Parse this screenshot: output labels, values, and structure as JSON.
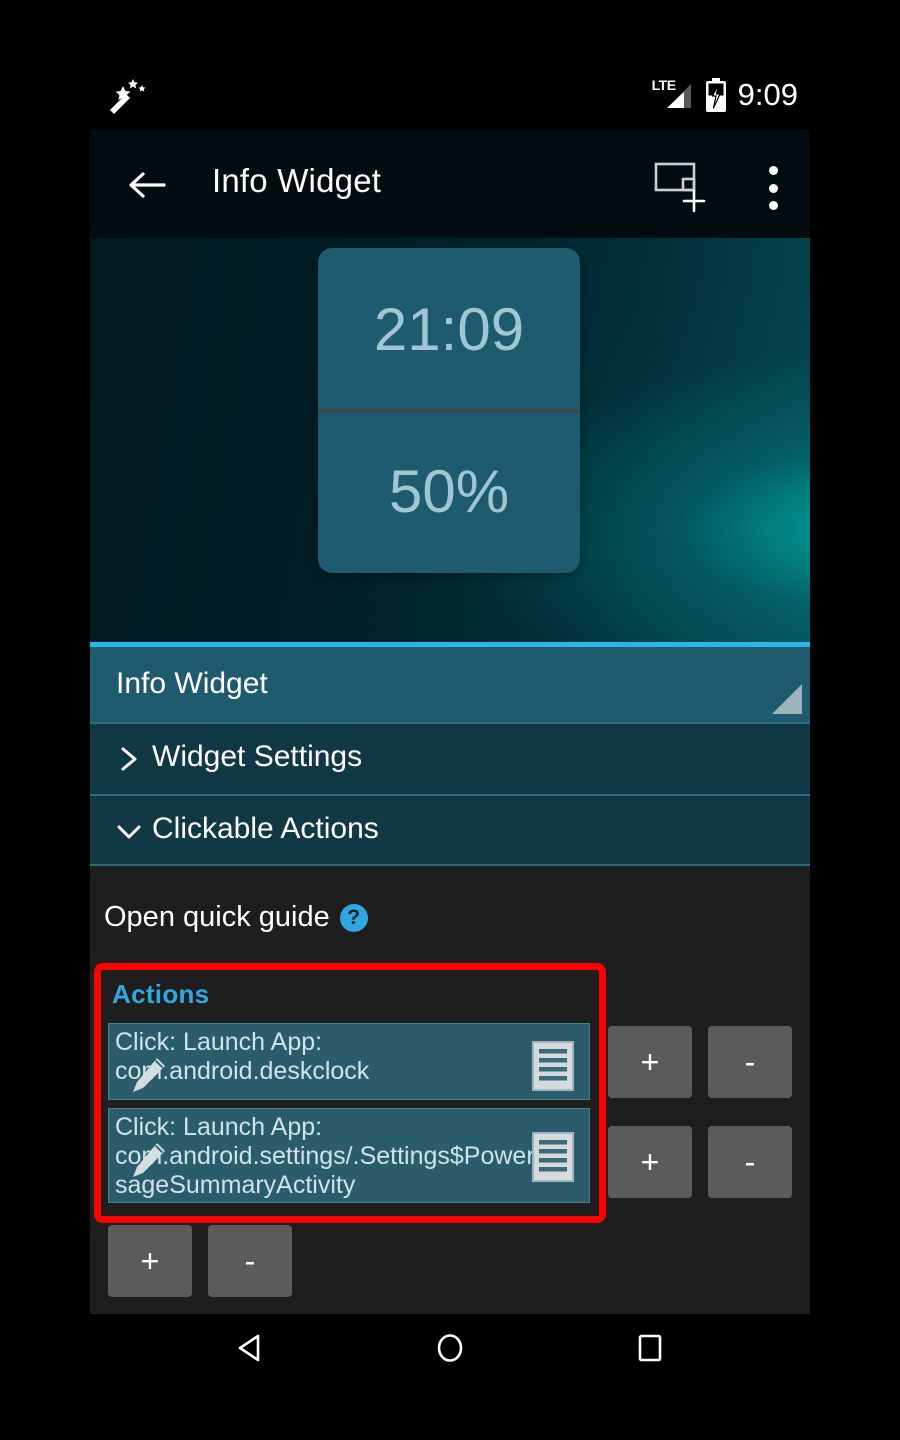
{
  "status_bar": {
    "notification_icon": "magic-wand-icon",
    "network_label": "LTE",
    "battery_icon": "battery-charging-icon",
    "battery_level_pct": 50,
    "clock": "9:09"
  },
  "app_bar": {
    "back_icon": "back-arrow-icon",
    "title": "Info Widget",
    "add_widget_icon": "add-widget-icon",
    "overflow_icon": "overflow-menu-icon"
  },
  "preview": {
    "widget_time": "21:09",
    "widget_battery": "50%"
  },
  "sections": {
    "widget_name": "Info Widget",
    "widget_settings": {
      "label": "Widget Settings",
      "chevron": "chevron-right-icon",
      "expanded": false
    },
    "clickable_actions": {
      "label": "Clickable Actions",
      "chevron": "chevron-down-icon",
      "expanded": true
    }
  },
  "content": {
    "quick_guide_label": "Open quick guide",
    "quick_guide_icon": "help-icon",
    "actions_heading": "Actions",
    "actions": [
      {
        "text": "Click: Launch App: com.android.deskclock",
        "edit_icon": "pencil-icon",
        "list_icon": "document-list-icon",
        "add_label": "+",
        "remove_label": "-"
      },
      {
        "text": "Click: Launch App: com.android.settings/.Settings$PowerUsageSummaryActivity",
        "edit_icon": "pencil-icon",
        "list_icon": "document-list-icon",
        "add_label": "+",
        "remove_label": "-"
      }
    ],
    "extra_controls": {
      "add_label": "+",
      "remove_label": "-"
    }
  },
  "nav_bar": {
    "back_icon": "nav-back-triangle-icon",
    "home_icon": "nav-home-circle-icon",
    "recents_icon": "nav-recents-square-icon"
  },
  "colors": {
    "accent_cyan": "#29b6e8",
    "teal_header": "#1f5b6e",
    "teal_section": "#103845",
    "action_row": "#2a5c6b",
    "highlight_red": "#ff0000",
    "button_grey": "#5b5b5b",
    "body_background": "#1e1e1e"
  }
}
